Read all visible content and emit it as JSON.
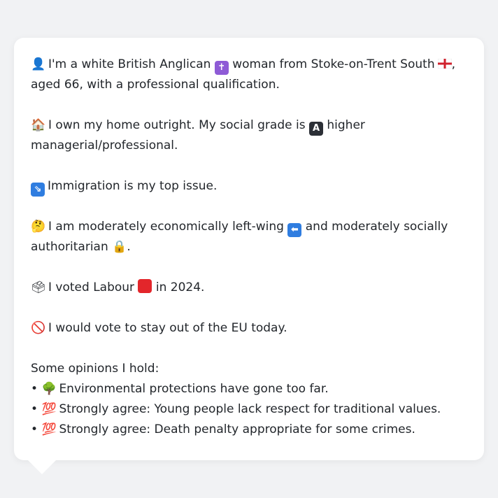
{
  "lines": {
    "identity": {
      "emoji": "👤",
      "text_a": "I'm a white British Anglican",
      "cross_icon": "✝",
      "text_b": "woman from Stoke-on-Trent South",
      "text_c": ",",
      "text_d": "aged 66, with a professional qualification."
    },
    "home": {
      "emoji": "🏠",
      "text_a": "I own my home outright. My social grade is",
      "grade_icon": "A",
      "text_b": "higher",
      "text_c": "managerial/professional."
    },
    "issue": {
      "emoji": "⇘",
      "text": "Immigration is my top issue."
    },
    "politics": {
      "emoji": "🤔",
      "text_a": "I am moderately economically left-wing",
      "left_icon": "⬅",
      "text_b": "and moderately socially",
      "text_c": "authoritarian",
      "lock_icon": "🔒",
      "text_d": "."
    },
    "vote": {
      "emoji": "🗳",
      "text_a": "I voted Labour",
      "text_b": "in 2024."
    },
    "eu": {
      "emoji": "🚫",
      "text": "I would vote to stay out of the EU today."
    }
  },
  "opinions": {
    "heading": "Some opinions I hold:",
    "items": [
      {
        "bullet": "•",
        "emoji": "🌳",
        "text": "Environmental protections have gone too far."
      },
      {
        "bullet": "•",
        "emoji": "💯",
        "text": "Strongly agree: Young people lack respect for traditional values."
      },
      {
        "bullet": "•",
        "emoji": "💯",
        "text": "Strongly agree: Death penalty appropriate for some crimes."
      }
    ]
  },
  "colors": {
    "background": "#f1f2f4",
    "bubble": "#ffffff",
    "text": "#22262b",
    "labour_red": "#e3262b"
  }
}
